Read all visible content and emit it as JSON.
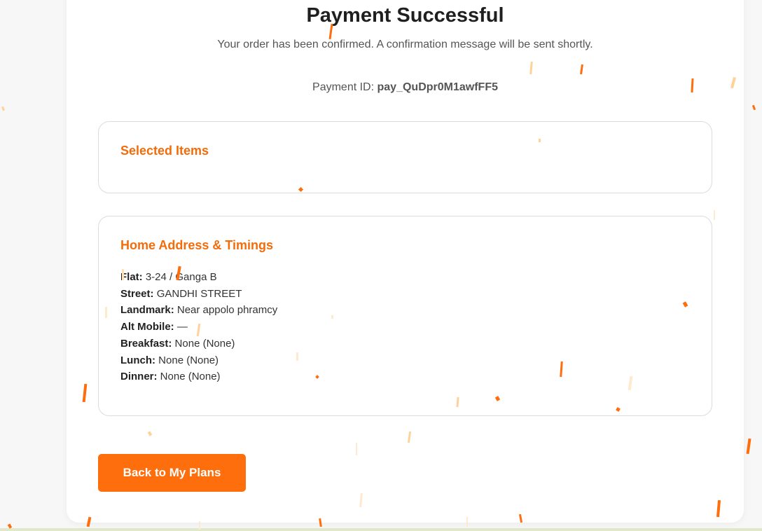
{
  "header": {
    "title": "Payment Successful",
    "subtitle": "Your order has been confirmed. A confirmation message will be sent shortly.",
    "payment_id_label": "Payment ID:",
    "payment_id_value": "pay_QuDpr0M1awfFF5"
  },
  "selected_items": {
    "title": "Selected Items"
  },
  "address": {
    "title": "Home Address & Timings",
    "rows": [
      {
        "label": "Flat:",
        "value": "3-24 / Ganga B"
      },
      {
        "label": "Street:",
        "value": "GANDHI STREET"
      },
      {
        "label": "Landmark:",
        "value": "Near appolo phramcy"
      },
      {
        "label": "Alt Mobile:",
        "value": "—"
      },
      {
        "label": "Breakfast:",
        "value": "None (None)"
      },
      {
        "label": "Lunch:",
        "value": "None (None)"
      },
      {
        "label": "Dinner:",
        "value": "None (None)"
      }
    ]
  },
  "actions": {
    "back_label": "Back to My Plans"
  },
  "colors": {
    "accent": "#ff6e0d",
    "section_title": "#f36c0a",
    "confetti_light": "#ffd29a"
  }
}
